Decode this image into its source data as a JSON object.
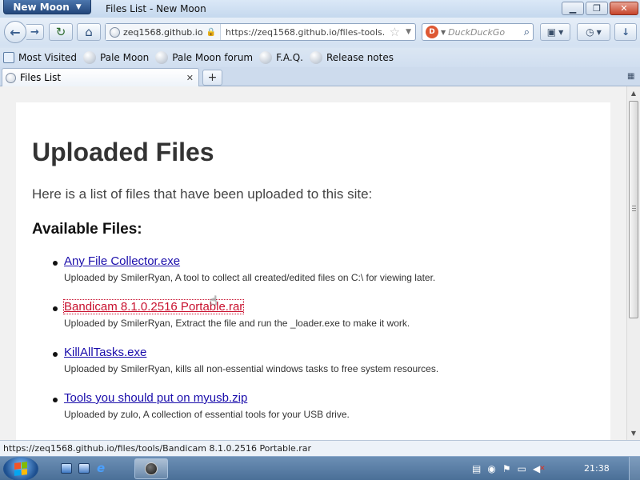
{
  "window": {
    "app_menu_label": "New Moon",
    "title": "Files List - New Moon",
    "minimize_glyph": "▁",
    "maximize_glyph": "❐",
    "close_glyph": "✕"
  },
  "navbar": {
    "back_glyph": "←",
    "forward_glyph": "→",
    "reload_glyph": "↻",
    "home_glyph": "⌂",
    "url_identity": "zeq1568.github.io",
    "url": "https://zeq1568.github.io/files-tools.",
    "search_placeholder": "DuckDuckGo",
    "search_engine_icon": "duckduckgo-icon"
  },
  "bookmarks_toolbar": {
    "items": [
      {
        "label": "Most Visited",
        "icon": "most-visited-icon"
      },
      {
        "label": "Pale Moon",
        "icon": "bookmark-globe-icon"
      },
      {
        "label": "Pale Moon forum",
        "icon": "bookmark-globe-icon"
      },
      {
        "label": "F.A.Q.",
        "icon": "bookmark-globe-icon"
      },
      {
        "label": "Release notes",
        "icon": "bookmark-globe-icon"
      }
    ]
  },
  "tabs": {
    "active": {
      "label": "Files List"
    },
    "new_tab_glyph": "+"
  },
  "page": {
    "heading": "Uploaded Files",
    "intro": "Here is a list of files that have been uploaded to this site:",
    "available_heading": "Available Files:",
    "files": [
      {
        "name": "Any File Collector.exe",
        "description": "Uploaded by SmilerRyan, A tool to collect all created/edited files on C:\\ for viewing later.",
        "hovered": false
      },
      {
        "name": "Bandicam 8.1.0.2516 Portable.rar",
        "description": "Uploaded by SmilerRyan, Extract the file and run the _loader.exe to make it work.",
        "hovered": true
      },
      {
        "name": "KillAllTasks.exe",
        "description": "Uploaded by SmilerRyan, kills all non-essential windows tasks to free system resources.",
        "hovered": false
      },
      {
        "name": "Tools you should put on myusb.zip",
        "description": "Uploaded by zulo, A collection of essential tools for your USB drive.",
        "hovered": false
      }
    ]
  },
  "statusbar": {
    "text": "https://zeq1568.github.io/files/tools/Bandicam 8.1.0.2516 Portable.rar"
  },
  "taskbar": {
    "clock": "21:38"
  },
  "colors": {
    "link": "#1a0dab",
    "link_hover": "#c8102e",
    "chrome_blue": "#d6e3f2"
  }
}
